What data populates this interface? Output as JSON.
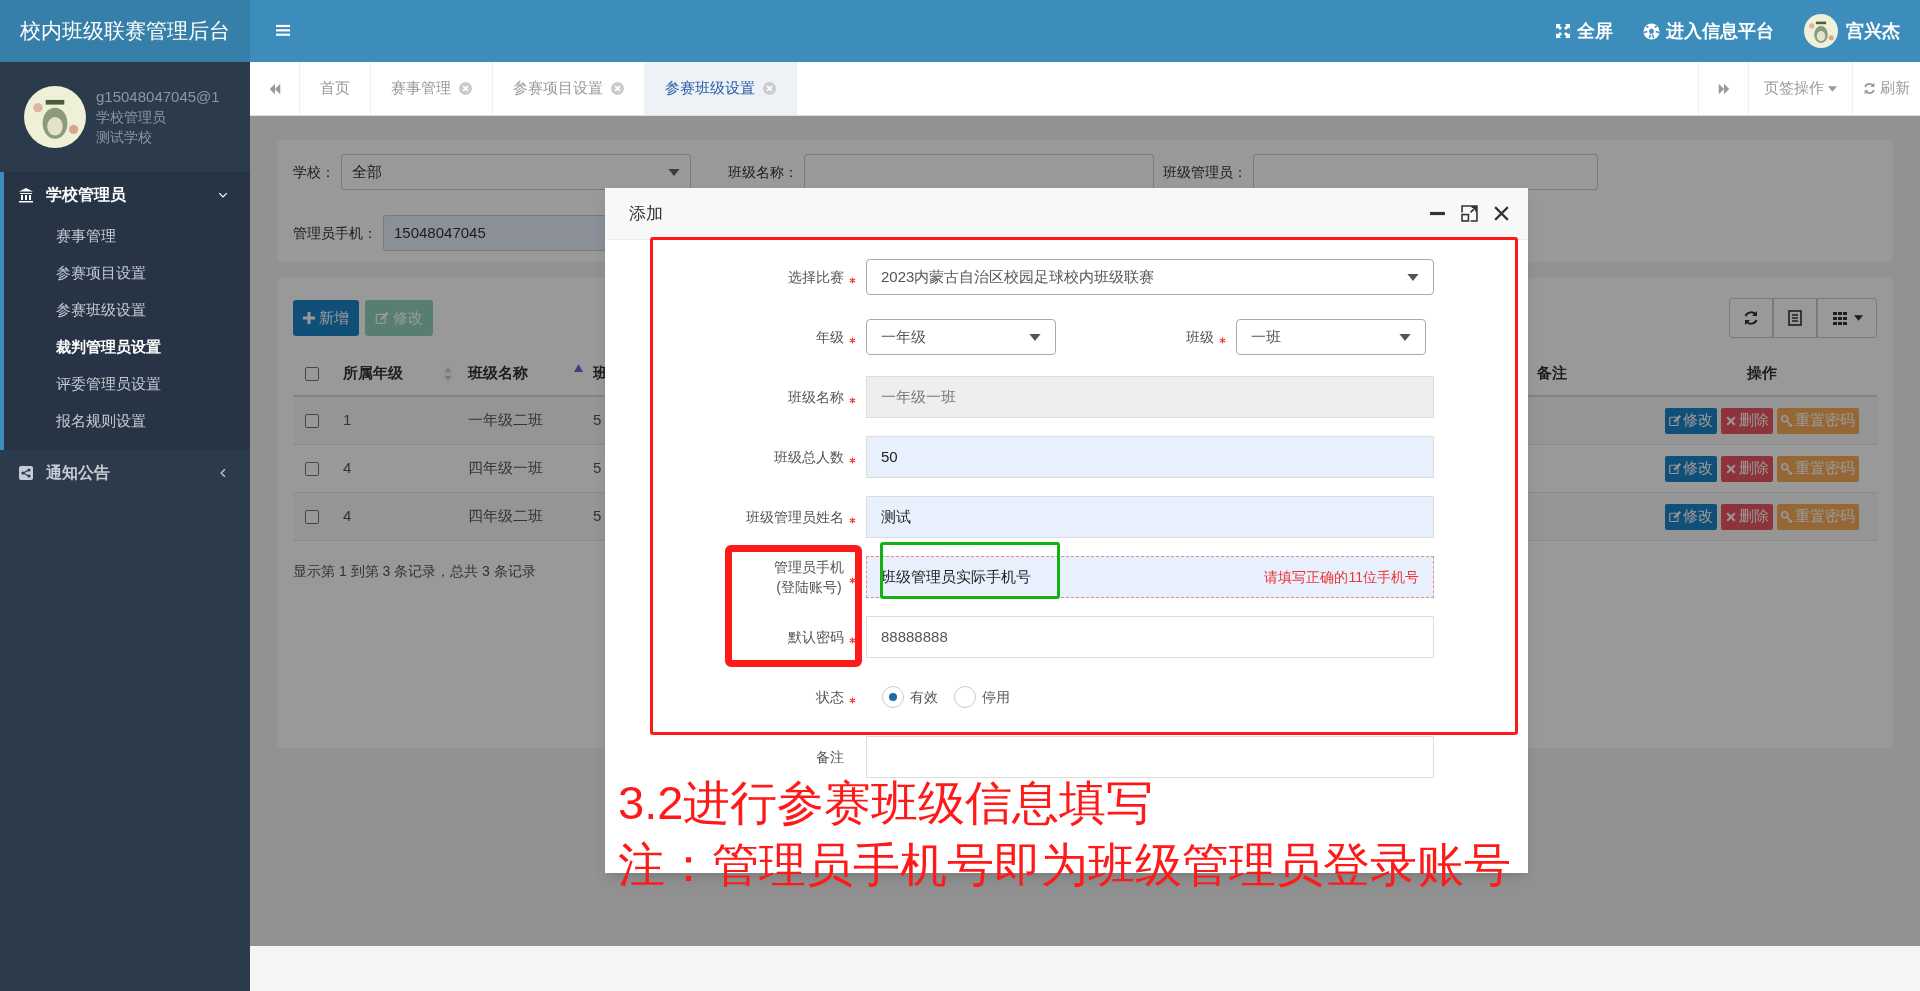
{
  "header": {
    "title": "校内班级联赛管理后台",
    "actions": [
      {
        "kind": "fullscreen",
        "label": "全屏"
      },
      {
        "kind": "platform",
        "label": "进入信息平台"
      }
    ],
    "user": "宫兴杰"
  },
  "sidebar": {
    "account": "g15048047045@1",
    "role": "学校管理员",
    "school": "测试学校",
    "menu": [
      {
        "label": "学校管理员",
        "kind": "bank",
        "expanded": true,
        "children": [
          {
            "label": "赛事管理",
            "selected": false
          },
          {
            "label": "参赛项目设置",
            "selected": false
          },
          {
            "label": "参赛班级设置",
            "selected": false
          },
          {
            "label": "裁判管理员设置",
            "selected": true
          },
          {
            "label": "评委管理员设置",
            "selected": false
          },
          {
            "label": "报名规则设置",
            "selected": false
          }
        ]
      },
      {
        "label": "通知公告",
        "kind": "share",
        "expanded": false
      }
    ]
  },
  "tabs": [
    {
      "label": "首页",
      "closable": false,
      "selected": false
    },
    {
      "label": "赛事管理",
      "closable": true,
      "selected": false
    },
    {
      "label": "参赛项目设置",
      "closable": true,
      "selected": false
    },
    {
      "label": "参赛班级设置",
      "closable": true,
      "selected": true
    }
  ],
  "tab_tools": {
    "menu": "页签操作",
    "refresh": "刷新"
  },
  "filters": [
    {
      "label": "学校：",
      "kind": "select",
      "value": "全部"
    },
    {
      "label": "班级名称：",
      "kind": "input"
    },
    {
      "label": "班级管理员：",
      "kind": "input"
    },
    {
      "label": "管理员手机：",
      "kind": "input",
      "value": "15048047045"
    }
  ],
  "toolbar": [
    {
      "label": "新增",
      "kind": "add",
      "disabled": false
    },
    {
      "label": "修改",
      "kind": "edit",
      "disabled": true
    }
  ],
  "table": {
    "select_all_checked": false,
    "columns": [
      {
        "label": "所属年级",
        "sortable": true,
        "sorted": false
      },
      {
        "label": "班级名称",
        "sortable": true,
        "sorted": true
      },
      {
        "label": "班"
      },
      {
        "label": "备注"
      },
      {
        "label": "操作"
      }
    ],
    "rows": [
      {
        "checked": false,
        "cells": [
          "1",
          "一年级二班",
          "5"
        ],
        "actions": [
          "修改",
          "删除",
          "重置密码"
        ]
      },
      {
        "checked": false,
        "cells": [
          "4",
          "四年级一班",
          "5"
        ],
        "actions": [
          "修改",
          "删除",
          "重置密码"
        ]
      },
      {
        "checked": false,
        "cells": [
          "4",
          "四年级二班",
          "5"
        ],
        "actions": [
          "修改",
          "删除",
          "重置密码"
        ]
      }
    ]
  },
  "pagination": "显示第 1 到第 3 条记录，总共 3 条记录",
  "dialog": {
    "title": "添加",
    "rows": [
      {
        "fields": [
          {
            "label": "选择比赛",
            "required": true,
            "kind": "select",
            "value": "2023内蒙古自治区校园足球校内班级联赛"
          }
        ]
      },
      {
        "fields": [
          {
            "label": "年级",
            "required": true,
            "kind": "select",
            "value": "一年级"
          },
          {
            "label": "班级",
            "required": true,
            "kind": "select",
            "value": "一班"
          }
        ]
      },
      {
        "fields": [
          {
            "label": "班级名称",
            "required": true,
            "kind": "readonly",
            "value": "一年级一班"
          }
        ]
      },
      {
        "fields": [
          {
            "label": "班级总人数",
            "required": true,
            "kind": "input",
            "filled": true,
            "value": "50"
          }
        ]
      },
      {
        "fields": [
          {
            "label": "班级管理员姓名",
            "required": true,
            "kind": "input",
            "filled": true,
            "value": "测试"
          }
        ]
      },
      {
        "fields": [
          {
            "label": "管理员手机",
            "sublabel": "(登陆账号)",
            "required": true,
            "kind": "input",
            "filled": true,
            "value": "班级管理员实际手机号",
            "error": "请填写正确的11位手机号"
          }
        ]
      },
      {
        "fields": [
          {
            "label": "默认密码",
            "required": true,
            "kind": "input",
            "filled": false,
            "value": "88888888"
          }
        ]
      },
      {
        "fields": [
          {
            "label": "状态",
            "required": true,
            "kind": "radio",
            "options": [
              {
                "label": "有效",
                "selected": true
              },
              {
                "label": "停用",
                "selected": false
              }
            ]
          }
        ]
      },
      {
        "fields": [
          {
            "label": "备注",
            "required": false,
            "kind": "input",
            "filled": false
          }
        ]
      }
    ]
  },
  "annotations": [
    "3.2进行参赛班级信息填写",
    "注：管理员手机号即为班级管理员登录账号"
  ]
}
